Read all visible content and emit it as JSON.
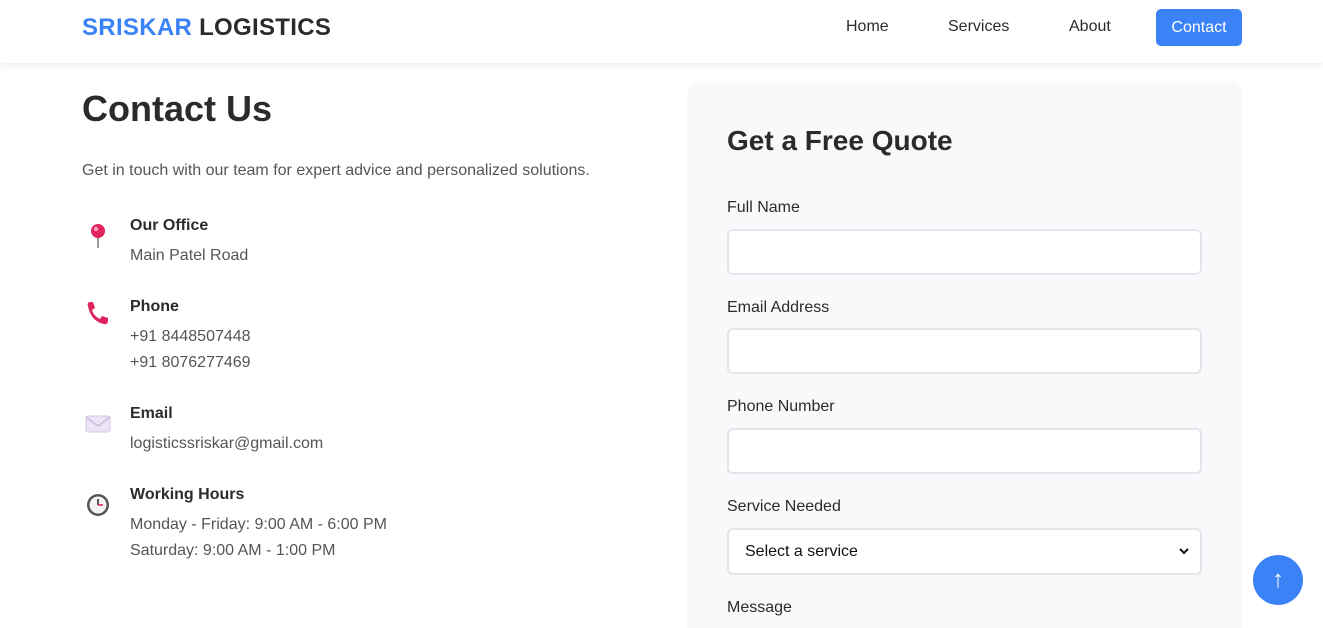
{
  "header": {
    "brand_part1": "SRISKAR",
    "brand_part2": "LOGISTICS",
    "nav": [
      "Home",
      "Services",
      "About",
      "Contact"
    ]
  },
  "main": {
    "title": "Contact Us",
    "intro": "Get in touch with our team for expert advice and personalized solutions.",
    "office": {
      "icon": "pin-icon",
      "heading": "Our Office",
      "lines": [
        "Main Patel Road"
      ]
    },
    "phone": {
      "icon": "phone-icon",
      "heading": "Phone",
      "lines": [
        "+91 8448507448",
        "+91 8076277469"
      ]
    },
    "email": {
      "icon": "envelope-icon",
      "heading": "Email",
      "lines": [
        "logisticssriskar@gmail.com"
      ]
    },
    "hours": {
      "icon": "clock-icon",
      "heading": "Working Hours",
      "lines": [
        "Monday - Friday: 9:00 AM - 6:00 PM",
        "Saturday: 9:00 AM - 1:00 PM"
      ]
    }
  },
  "quote_form": {
    "title": "Get a Free Quote",
    "full_name_label": "Full Name",
    "full_name_value": "",
    "email_label": "Email Address",
    "email_value": "",
    "phone_label": "Phone Number",
    "phone_value": "",
    "service_label": "Service Needed",
    "service_selected": "Select a service",
    "message_label": "Message"
  },
  "scroll_top": {
    "icon": "arrow-up-icon",
    "glyph": "↑"
  },
  "colors": {
    "accent": "#3b82f6",
    "text": "#2b2b2b",
    "muted": "#555555",
    "card": "#f8f9fb"
  }
}
